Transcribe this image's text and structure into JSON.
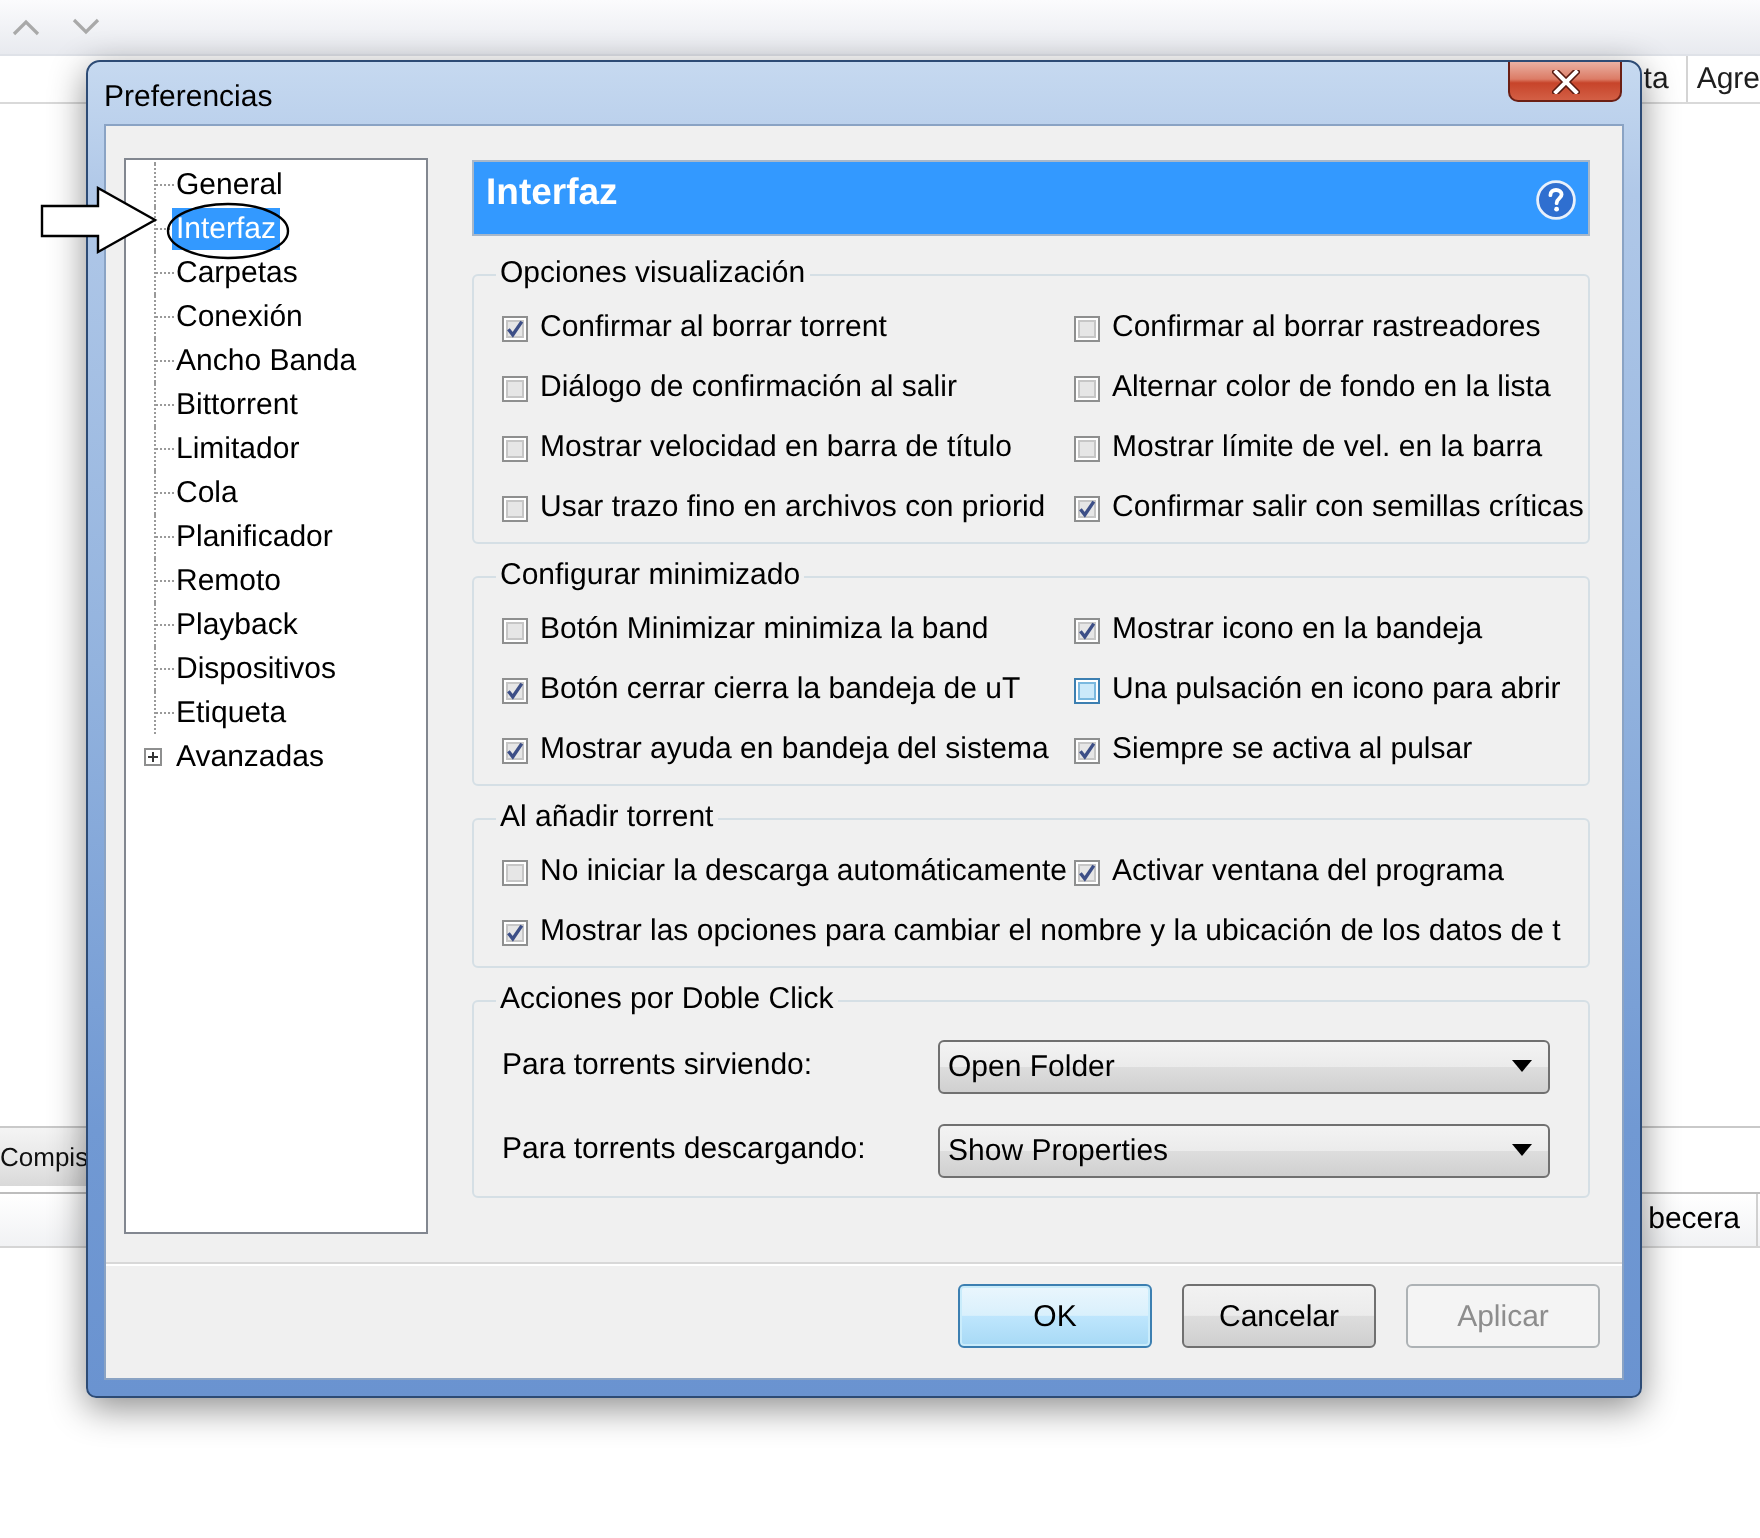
{
  "background_app": {
    "header_cells": [
      "ta",
      "Agre"
    ],
    "tab": "Compis",
    "column_header": "becera"
  },
  "window": {
    "title": "Preferencias"
  },
  "sidebar": {
    "items": [
      {
        "label": "General",
        "kind": "leaf",
        "selected": false
      },
      {
        "label": "Interfaz",
        "kind": "leaf",
        "selected": true
      },
      {
        "label": "Carpetas",
        "kind": "leaf",
        "selected": false
      },
      {
        "label": "Conexión",
        "kind": "leaf",
        "selected": false
      },
      {
        "label": "Ancho Banda",
        "kind": "leaf",
        "selected": false
      },
      {
        "label": "Bittorrent",
        "kind": "leaf",
        "selected": false
      },
      {
        "label": "Limitador",
        "kind": "leaf",
        "selected": false
      },
      {
        "label": "Cola",
        "kind": "leaf",
        "selected": false
      },
      {
        "label": "Planificador",
        "kind": "leaf",
        "selected": false
      },
      {
        "label": "Remoto",
        "kind": "leaf",
        "selected": false
      },
      {
        "label": "Playback",
        "kind": "leaf",
        "selected": false
      },
      {
        "label": "Dispositivos",
        "kind": "leaf",
        "selected": false
      },
      {
        "label": "Etiqueta",
        "kind": "leaf",
        "selected": false
      },
      {
        "label": "Avanzadas",
        "kind": "group",
        "expanded": false,
        "selected": false
      }
    ]
  },
  "panel": {
    "title": "Interfaz",
    "groups": [
      {
        "kind": "checkboxes",
        "title": "Opciones visualización",
        "rows": [
          [
            {
              "label": "Confirmar al borrar torrent",
              "checked": true,
              "hovered": false
            },
            {
              "label": "Confirmar al borrar rastreadores",
              "checked": false,
              "hovered": false
            }
          ],
          [
            {
              "label": "Diálogo de confirmación al salir",
              "checked": false,
              "hovered": false
            },
            {
              "label": "Alternar color de fondo en la lista",
              "checked": false,
              "hovered": false
            }
          ],
          [
            {
              "label": "Mostrar velocidad en barra de título",
              "checked": false,
              "hovered": false
            },
            {
              "label": "Mostrar límite de vel. en la barra",
              "checked": false,
              "hovered": false
            }
          ],
          [
            {
              "label": "Usar trazo fino en archivos con priorid",
              "checked": false,
              "hovered": false
            },
            {
              "label": "Confirmar salir con semillas críticas",
              "checked": true,
              "hovered": false
            }
          ]
        ]
      },
      {
        "kind": "checkboxes",
        "title": "Configurar minimizado",
        "rows": [
          [
            {
              "label": "Botón Minimizar minimiza la band",
              "checked": false,
              "hovered": false
            },
            {
              "label": "Mostrar icono en la bandeja",
              "checked": true,
              "hovered": false
            }
          ],
          [
            {
              "label": "Botón cerrar cierra la bandeja de uT",
              "checked": true,
              "hovered": false
            },
            {
              "label": "Una pulsación en icono para abrir",
              "checked": false,
              "hovered": true
            }
          ],
          [
            {
              "label": "Mostrar ayuda en bandeja del sistema",
              "checked": true,
              "hovered": false
            },
            {
              "label": "Siempre se activa al pulsar",
              "checked": true,
              "hovered": false
            }
          ]
        ]
      },
      {
        "kind": "checkboxes",
        "title": "Al añadir torrent",
        "rows": [
          [
            {
              "label": "No iniciar la descarga automáticamente",
              "checked": false,
              "hovered": false
            },
            {
              "label": "Activar ventana del programa",
              "checked": true,
              "hovered": false
            }
          ],
          [
            {
              "label": "Mostrar las opciones para cambiar el nombre y la ubicación de los datos de t",
              "checked": true,
              "hovered": false
            }
          ]
        ]
      },
      {
        "kind": "dropdowns",
        "title": "Acciones por Doble Click",
        "fields": [
          {
            "label": "Para torrents sirviendo:",
            "value": "Open Folder"
          },
          {
            "label": "Para torrents descargando:",
            "value": "Show Properties"
          }
        ]
      }
    ]
  },
  "buttons": [
    {
      "label": "OK",
      "default": true,
      "disabled": false
    },
    {
      "label": "Cancelar",
      "default": false,
      "disabled": false
    },
    {
      "label": "Aplicar",
      "default": false,
      "disabled": true
    }
  ]
}
